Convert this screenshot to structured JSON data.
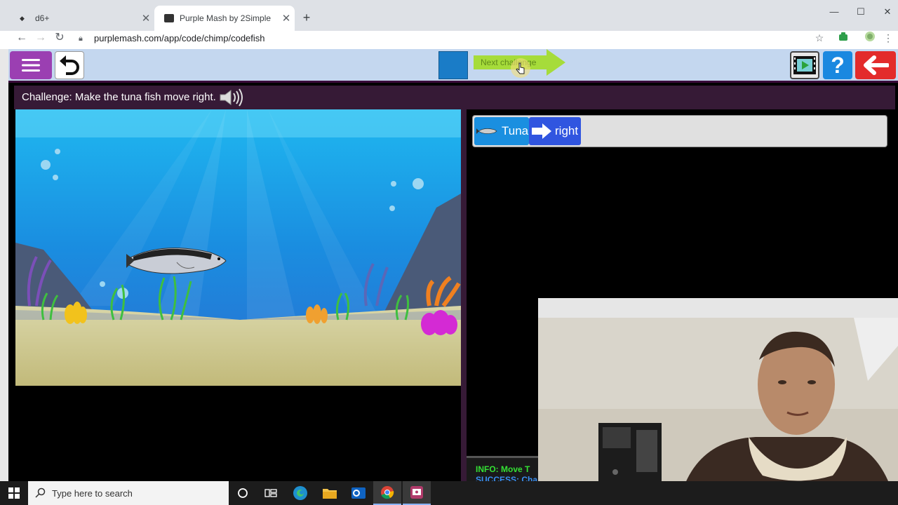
{
  "browser": {
    "tabs": [
      {
        "title": "d6+",
        "active": false
      },
      {
        "title": "Purple Mash by 2Simple",
        "active": true
      }
    ],
    "url": "purplemash.com/app/code/chimp/codefish"
  },
  "app": {
    "next_challenge_label": "Next challenge",
    "challenge_text": "Challenge: Make the tuna fish move right.",
    "code": {
      "object_label": "Tuna",
      "action_label": "right"
    },
    "console": {
      "info": "INFO: Move T",
      "success": "SUCCESS: Cha"
    }
  },
  "taskbar": {
    "search_placeholder": "Type here to search"
  },
  "colors": {
    "app_bar": "#c4d7ef",
    "menu_button": "#9b3fb2",
    "help_button": "#1a88e0",
    "back_button": "#e32b2b",
    "next_button": "#a6dc3a",
    "tuna_block": "#1a8fe0",
    "direction_block": "#3055e0"
  }
}
